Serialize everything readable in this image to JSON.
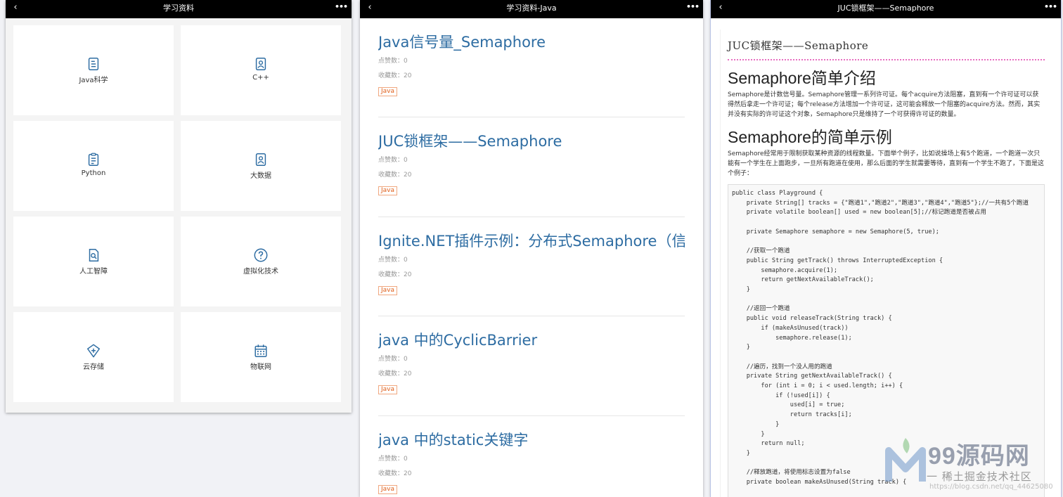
{
  "panel1": {
    "title": "学习资料",
    "categories": [
      {
        "label": "Java科学",
        "icon": "document-icon"
      },
      {
        "label": "C++",
        "icon": "profile-doc-icon"
      },
      {
        "label": "Python",
        "icon": "document-icon"
      },
      {
        "label": "大数据",
        "icon": "profile-doc-icon"
      },
      {
        "label": "人工智障",
        "icon": "search-doc-icon"
      },
      {
        "label": "虚拟化技术",
        "icon": "question-circle-icon"
      },
      {
        "label": "云存储",
        "icon": "diamond-plus-icon"
      },
      {
        "label": "物联网",
        "icon": "calendar-icon"
      }
    ]
  },
  "panel2": {
    "title": "学习资料-Java",
    "items": [
      {
        "title": "Java信号量_Semaphore",
        "likes": "点赞数：0",
        "favs": "收藏数：20",
        "tag": "Java"
      },
      {
        "title": "JUC锁框架——Semaphore",
        "likes": "点赞数：0",
        "favs": "收藏数：20",
        "tag": "Java"
      },
      {
        "title": "Ignite.NET插件示例：分布式Semaphore（信",
        "likes": "点赞数：0",
        "favs": "收藏数：20",
        "tag": "Java"
      },
      {
        "title": "java 中的CyclicBarrier",
        "likes": "点赞数：0",
        "favs": "收藏数：20",
        "tag": "Java"
      },
      {
        "title": "java 中的static关键字",
        "likes": "点赞数：0",
        "favs": "收藏数：20",
        "tag": "Java"
      }
    ]
  },
  "panel3": {
    "title": "JUC锁框架——Semaphore",
    "article_title": "JUC锁框架——Semaphore",
    "h1": "Semaphore简单介绍",
    "p1": "Semaphore是计数信号量。Semaphore管理一系列许可证。每个acquire方法阻塞，直到有一个许可证可以获得然后拿走一个许可证；每个release方法增加一个许可证，这可能会释放一个阻塞的acquire方法。然而，其实并没有实际的许可证这个对象，Semaphore只是维持了一个可获得许可证的数量。",
    "h2": "Semaphore的简单示例",
    "p2": "Semaphore经常用于限制获取某种资源的线程数量。下面举个例子，比如说操场上有5个跑道，一个跑道一次只能有一个学生在上面跑步，一旦所有跑道在使用，那么后面的学生就需要等待，直到有一个学生不跑了，下面是这个例子：",
    "code": "public class Playground {\n    private String[] tracks = {\"跑道1\",\"跑道2\",\"跑道3\",\"跑道4\",\"跑道5\"};//一共有5个跑道\n    private volatile boolean[] used = new boolean[5];//标记跑道是否被占用\n\n    private Semaphore semaphore = new Semaphore(5, true);\n\n    //获取一个跑道\n    public String getTrack() throws InterruptedException {\n        semaphore.acquire(1);\n        return getNextAvailableTrack();\n    }\n\n    //返回一个跑道\n    public void releaseTrack(String track) {\n        if (makeAsUnused(track))\n            semaphore.release(1);\n    }\n\n    //遍历，找到一个没人用的跑道\n    private String getNextAvailableTrack() {\n        for (int i = 0; i < used.length; i++) {\n            if (!used[i]) {\n                used[i] = true;\n                return tracks[i];\n            }\n        }\n        return null;\n    }\n\n    //释放跑道，将使用标志设置为false\n    private boolean makeAsUnused(String track) {"
  },
  "watermark": {
    "brand": "99源码网",
    "sub": "一 稀土掘金技术社区",
    "url": "https://blog.csdn.net/qq_44625080"
  },
  "colors": {
    "accent_link": "#2d6ca2",
    "tag": "#e0601c",
    "icon": "#2d6ca2",
    "divider": "#e86ec1"
  }
}
